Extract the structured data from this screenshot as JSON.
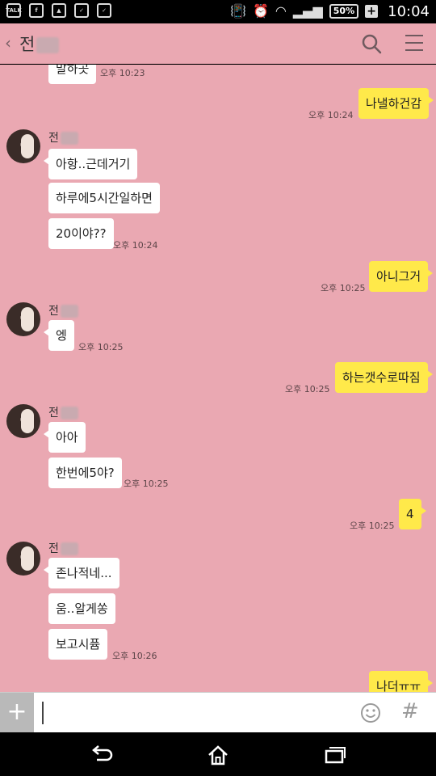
{
  "status_bar": {
    "icons_left": [
      "talk-icon",
      "facebook-icon",
      "gallery-icon",
      "checkbox-icon",
      "clipboard-icon"
    ],
    "talk_label": "TALK",
    "battery": "50%",
    "time": "10:04"
  },
  "header": {
    "back_glyph": "‹",
    "room_name": "전",
    "icons": [
      "search-icon",
      "menu-icon"
    ]
  },
  "sender_name": "전",
  "messages": [
    {
      "type": "in",
      "text": "말하곳",
      "time": "오후 10:23"
    },
    {
      "type": "out",
      "text": "나낼하건감",
      "time": "오후 10:24"
    },
    {
      "type": "in",
      "text": "아항..근데거기",
      "time": ""
    },
    {
      "type": "in",
      "text": "하루에5시간일하면",
      "time": ""
    },
    {
      "type": "in",
      "text": "20이야??",
      "time": "오후 10:24"
    },
    {
      "type": "out",
      "text": "아니그거",
      "time": "오후 10:25"
    },
    {
      "type": "in",
      "text": "엥",
      "time": "오후 10:25"
    },
    {
      "type": "out",
      "text": "하는갯수로따짐",
      "time": "오후 10:25"
    },
    {
      "type": "in",
      "text": "아아",
      "time": ""
    },
    {
      "type": "in",
      "text": "한번에5야?",
      "time": "오후 10:25"
    },
    {
      "type": "out",
      "text": "4",
      "time": "오후 10:25"
    },
    {
      "type": "in",
      "text": "존나적네...",
      "time": ""
    },
    {
      "type": "in",
      "text": "움..알게쏭",
      "time": ""
    },
    {
      "type": "in",
      "text": "보고시퓸",
      "time": "오후 10:26"
    },
    {
      "type": "out",
      "text": "나더ㅠㅠ",
      "time": ""
    }
  ],
  "input_bar": {
    "plus_label": "+",
    "input_value": "",
    "hash_label": "#"
  },
  "colors": {
    "chat_bg": "#eaa8b2",
    "outgoing_bubble": "#ffe94a",
    "incoming_bubble": "#ffffff"
  }
}
